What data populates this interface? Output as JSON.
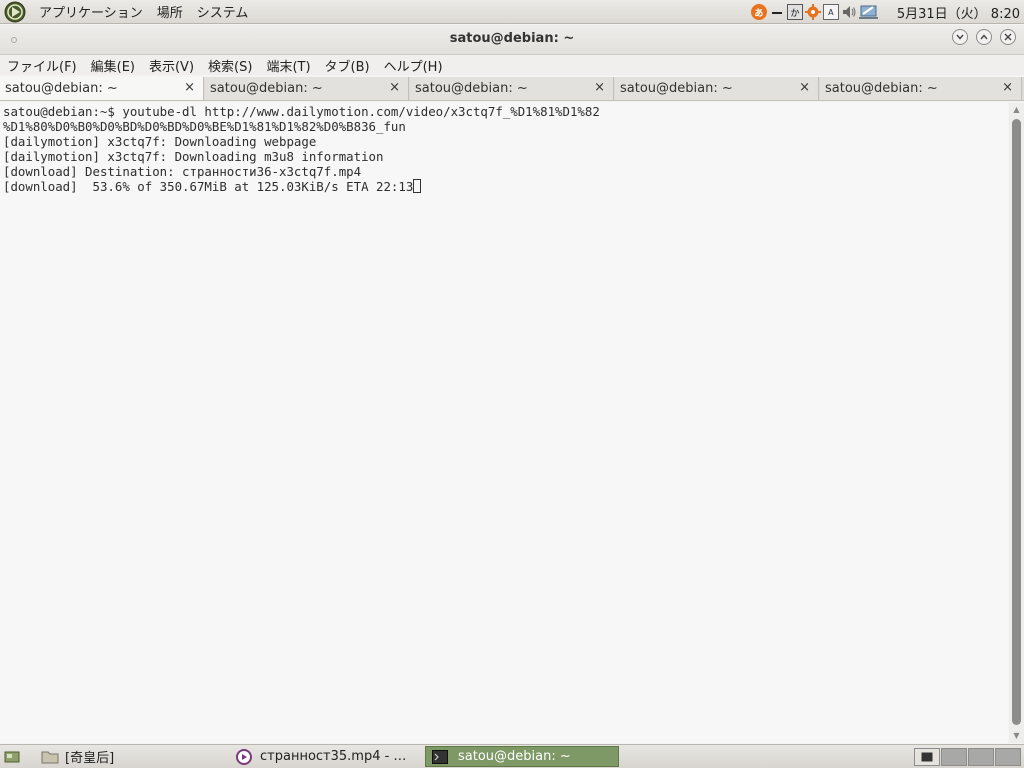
{
  "top_panel": {
    "menus": [
      "アプリケーション",
      "場所",
      "システム"
    ],
    "tray": {
      "input_icon": "あ",
      "mode_icon": "か",
      "ime_label": "A"
    },
    "clock": "5月31日（火） 8:20"
  },
  "window": {
    "title": "satou@debian: ~"
  },
  "menubar": [
    "ファイル(F)",
    "編集(E)",
    "表示(V)",
    "検索(S)",
    "端末(T)",
    "タブ(B)",
    "ヘルプ(H)"
  ],
  "tabs": [
    {
      "label": "satou@debian: ~",
      "close": "×"
    },
    {
      "label": "satou@debian: ~",
      "close": "×"
    },
    {
      "label": "satou@debian: ~",
      "close": "×"
    },
    {
      "label": "satou@debian: ~",
      "close": "×"
    },
    {
      "label": "satou@debian: ~",
      "close": "×"
    }
  ],
  "terminal": {
    "lines": [
      "satou@debian:~$ youtube-dl http://www.dailymotion.com/video/x3ctq7f_%D1%81%D1%82",
      "%D1%80%D0%B0%D0%BD%D0%BD%D0%BE%D1%81%D1%82%D0%B836_fun",
      "[dailymotion] x3ctq7f: Downloading webpage",
      "[dailymotion] x3ctq7f: Downloading m3u8 information",
      "[download] Destination: странности36-x3ctq7f.mp4",
      "[download]  53.6% of 350.67MiB at 125.03KiB/s ETA 22:13"
    ]
  },
  "taskbar": {
    "items": [
      {
        "label": "[奇皇后]"
      },
      {
        "label": "странност35.mp4 - …"
      },
      {
        "label": "satou@debian: ~"
      }
    ]
  },
  "colors": {
    "accent_green": "#7f9966",
    "tray_orange": "#e8731f"
  }
}
